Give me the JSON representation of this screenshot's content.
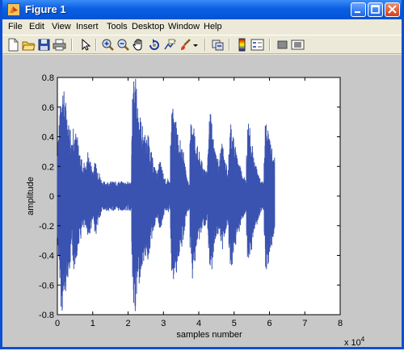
{
  "window": {
    "title": "Figure 1"
  },
  "menu": [
    "File",
    "Edit",
    "View",
    "Insert",
    "Tools",
    "Desktop",
    "Window",
    "Help"
  ],
  "toolbar": [
    "new-file-icon",
    "open-folder-icon",
    "save-icon",
    "print-icon",
    "select-arrow-icon",
    "zoom-in-icon",
    "zoom-out-icon",
    "pan-hand-icon",
    "rotate-3d-icon",
    "data-cursor-icon",
    "brush-icon",
    "link-plot-icon",
    "colorbar-icon",
    "legend-icon",
    "hide-plot-tools-icon",
    "show-plot-tools-icon"
  ],
  "colors": {
    "titlebar": "#0a5fe3",
    "waveform": "#3a52b0",
    "figure_bg": "#c8c8c8"
  },
  "chart_data": {
    "type": "line",
    "title": "",
    "xlabel": "samples number",
    "ylabel": "amplitude",
    "xlim": [
      0,
      8
    ],
    "ylim": [
      -0.8,
      0.8
    ],
    "x_ticks": [
      "0",
      "1",
      "2",
      "3",
      "4",
      "5",
      "6",
      "7",
      "8"
    ],
    "y_ticks": [
      "0.8",
      "0.6",
      "0.4",
      "0.2",
      "0",
      "-0.2",
      "-0.4",
      "-0.6",
      "-0.8"
    ],
    "x_exponent": "x 10",
    "x_exponent_power": "4",
    "grid": false,
    "series": [
      {
        "x_step": 0.025,
        "envelope": [
          0.35,
          0.45,
          0.56,
          0.62,
          0.75,
          0.8,
          0.76,
          0.72,
          0.68,
          0.65,
          0.6,
          0.55,
          0.5,
          0.52,
          0.48,
          0.42,
          0.38,
          0.45,
          0.52,
          0.48,
          0.44,
          0.42,
          0.4,
          0.36,
          0.32,
          0.28,
          0.3,
          0.26,
          0.22,
          0.2,
          0.24,
          0.2,
          0.22,
          0.24,
          0.3,
          0.28,
          0.26,
          0.24,
          0.22,
          0.2,
          0.18,
          0.2,
          0.24,
          0.26,
          0.22,
          0.2,
          0.18,
          0.16,
          0.14,
          0.12,
          0.1,
          0.1,
          0.1,
          0.1,
          0.1,
          0.1,
          0.1,
          0.1,
          0.1,
          0.1,
          0.1,
          0.1,
          0.1,
          0.1,
          0.1,
          0.1,
          0.1,
          0.1,
          0.1,
          0.1,
          0.1,
          0.1,
          0.1,
          0.1,
          0.1,
          0.1,
          0.1,
          0.1,
          0.1,
          0.1,
          0.1,
          0.1,
          0.1,
          0.1,
          0.45,
          0.7,
          0.8,
          0.76,
          0.8,
          0.74,
          0.66,
          0.62,
          0.6,
          0.55,
          0.52,
          0.5,
          0.48,
          0.45,
          0.43,
          0.42,
          0.38,
          0.4,
          0.44,
          0.4,
          0.36,
          0.34,
          0.3,
          0.26,
          0.24,
          0.22,
          0.2,
          0.18,
          0.16,
          0.18,
          0.2,
          0.22,
          0.24,
          0.22,
          0.18,
          0.16,
          0.14,
          0.12,
          0.12,
          0.1,
          0.1,
          0.12,
          0.1,
          0.1,
          0.4,
          0.56,
          0.62,
          0.58,
          0.55,
          0.5,
          0.52,
          0.48,
          0.44,
          0.42,
          0.4,
          0.38,
          0.36,
          0.32,
          0.3,
          0.26,
          0.22,
          0.18,
          0.14,
          0.12,
          0.1,
          0.1,
          0.38,
          0.5,
          0.58,
          0.56,
          0.5,
          0.44,
          0.4,
          0.36,
          0.34,
          0.3,
          0.3,
          0.28,
          0.26,
          0.24,
          0.22,
          0.2,
          0.22,
          0.2,
          0.18,
          0.16,
          0.34,
          0.46,
          0.52,
          0.56,
          0.5,
          0.44,
          0.4,
          0.36,
          0.32,
          0.3,
          0.28,
          0.26,
          0.24,
          0.26,
          0.3,
          0.34,
          0.38,
          0.32,
          0.28,
          0.26,
          0.24,
          0.22,
          0.2,
          0.18,
          0.36,
          0.46,
          0.52,
          0.48,
          0.44,
          0.4,
          0.36,
          0.34,
          0.3,
          0.28,
          0.26,
          0.24,
          0.22,
          0.2,
          0.18,
          0.16,
          0.15,
          0.14,
          0.12,
          0.1,
          0.3,
          0.46,
          0.5,
          0.46,
          0.42,
          0.38,
          0.34,
          0.3,
          0.26,
          0.24,
          0.22,
          0.2,
          0.18,
          0.16,
          0.14,
          0.12,
          0.1,
          0.1,
          0.1,
          0.1,
          0.3,
          0.48,
          0.52,
          0.5,
          0.46,
          0.42,
          0.38,
          0.36,
          0.34,
          0.3,
          0.28,
          0.26
        ]
      }
    ]
  }
}
